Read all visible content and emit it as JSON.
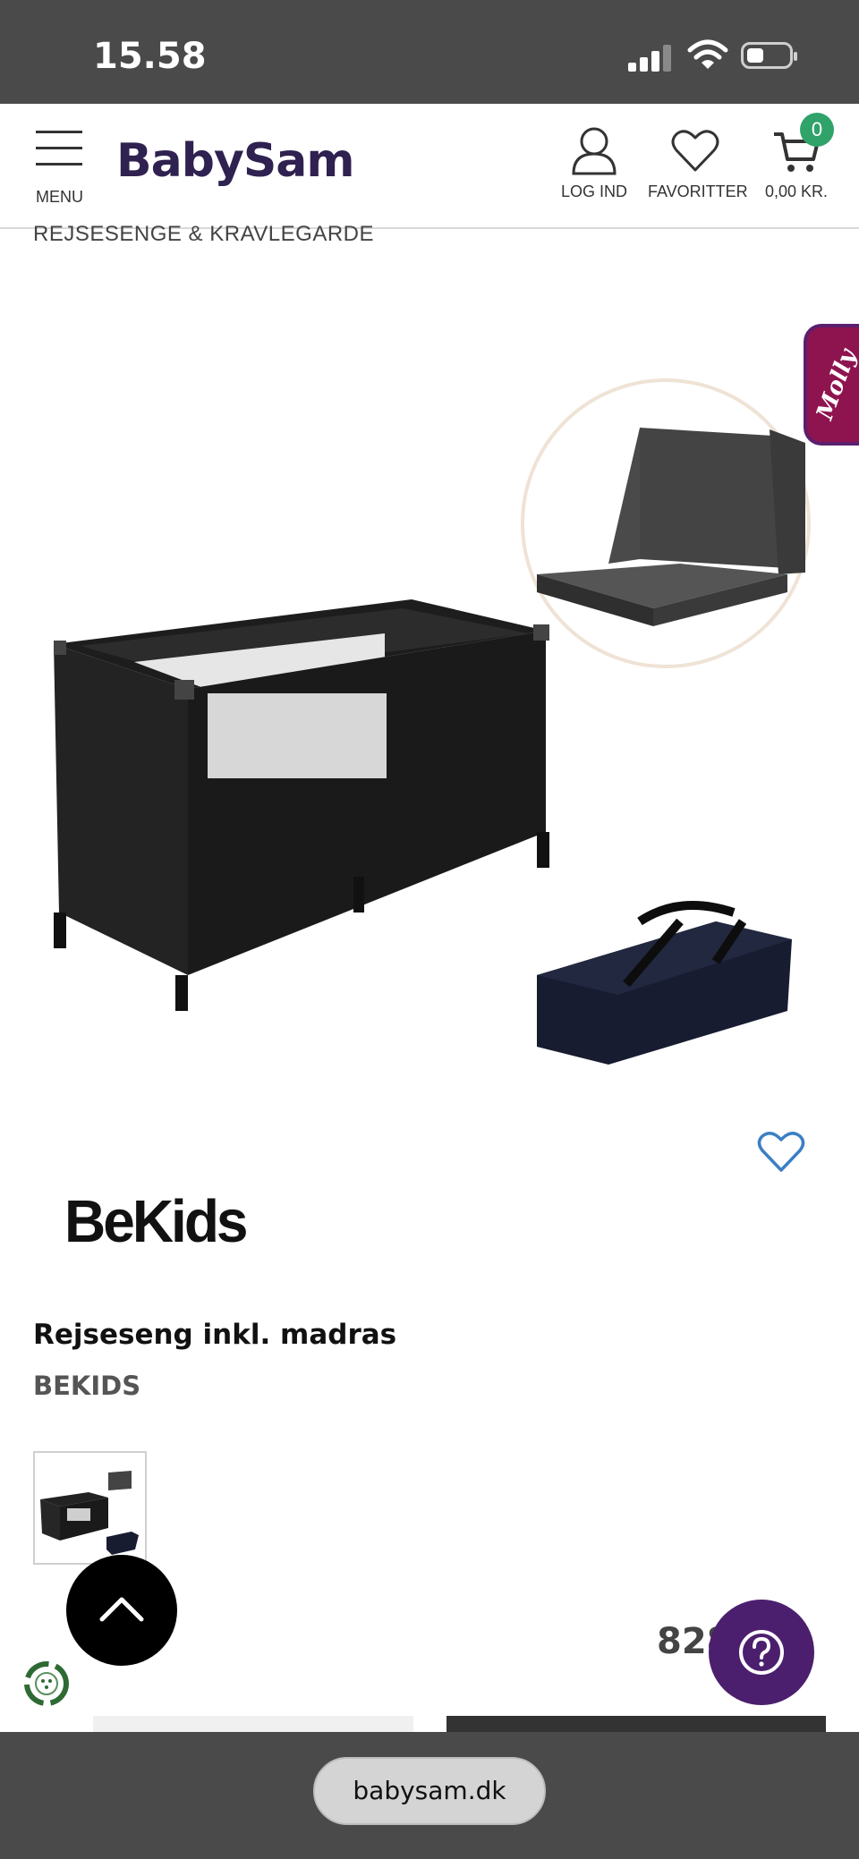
{
  "status_bar": {
    "time": "15.58"
  },
  "header": {
    "menu_label": "MENU",
    "logo": "BabySam",
    "login_label": "LOG IND",
    "favorites_label": "FAVORITTER",
    "cart_label": "0,00 KR.",
    "cart_count": "0"
  },
  "breadcrumb": "REJSESENGE & KRAVLEGARDE",
  "chat_tab": {
    "label": "Molly"
  },
  "product": {
    "brand_logo": "BeKids",
    "title": "Rejseseng inkl. madras",
    "brand": "BEKIDS",
    "price": "828"
  },
  "icons": {
    "scroll_top": "chevron-up-icon",
    "help": "question-icon",
    "favorite": "heart-icon",
    "eco": "recycle-icon"
  },
  "colors": {
    "brand": "#2f2150",
    "badge": "#2fa36a",
    "help_button": "#4b1f6e",
    "molly_tab": "#8e1450",
    "heart": "#3b7fc4"
  },
  "browser": {
    "url": "babysam.dk"
  }
}
